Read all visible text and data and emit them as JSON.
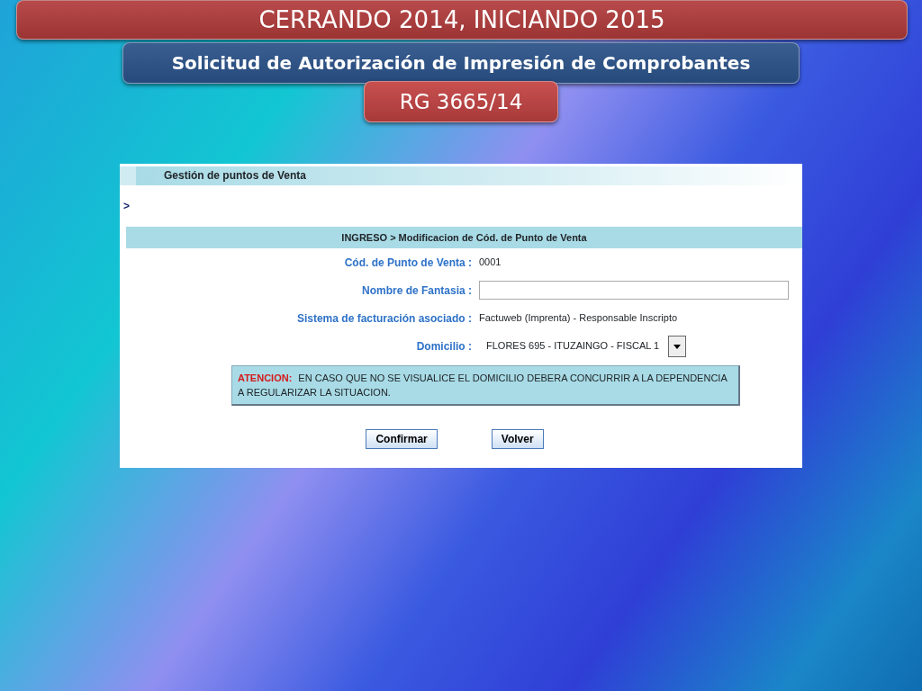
{
  "slide": {
    "title": "CERRANDO 2014, INICIANDO 2015",
    "subtitle": "Solicitud de Autorización de Impresión de Comprobantes",
    "tag": "RG 3665/14"
  },
  "app": {
    "header": "Gestión de puntos de Venta",
    "breadcrumb": ">",
    "section_title": "INGRESO > Modificacion de Cód. de Punto de Venta",
    "fields": [
      {
        "kind": "text",
        "label": "Cód. de Punto de Venta :",
        "value": "0001"
      },
      {
        "kind": "input",
        "label": "Nombre de Fantasia :"
      },
      {
        "kind": "text",
        "label": "Sistema de facturación asociado :",
        "value": "Factuweb (Imprenta) - Responsable Inscripto"
      },
      {
        "kind": "select",
        "label": "Domicilio :",
        "value": "FLORES 695 - ITUZAINGO - FISCAL 1"
      }
    ],
    "notice": {
      "label": "ATENCION:",
      "text": "EN CASO QUE NO SE VISUALICE EL DOMICILIO DEBERA CONCURRIR A LA DEPENDENCIA A REGULARIZAR LA SITUACION."
    },
    "buttons": [
      "Confirmar",
      "Volver"
    ]
  }
}
